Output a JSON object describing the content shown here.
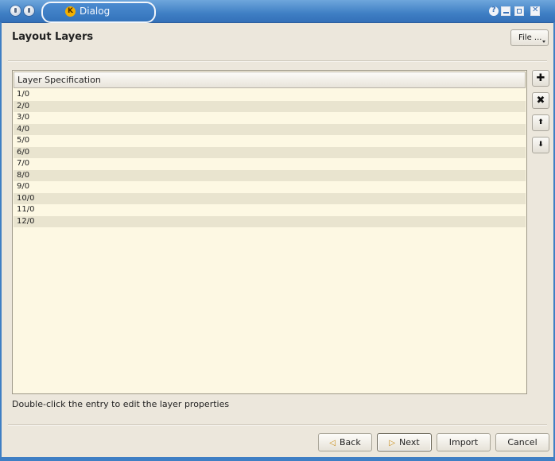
{
  "window": {
    "title": "Dialog",
    "logo_letter": "K"
  },
  "header": {
    "title": "Layout Layers",
    "file_button": "File ..."
  },
  "table": {
    "column_header": "Layer Specification",
    "rows": [
      "1/0",
      "2/0",
      "3/0",
      "4/0",
      "5/0",
      "6/0",
      "7/0",
      "8/0",
      "9/0",
      "10/0",
      "11/0",
      "12/0"
    ]
  },
  "side_buttons": {
    "add": "✚",
    "remove": "✖",
    "up": "⬆",
    "down": "⬇"
  },
  "hint": "Double-click the entry to edit the layer properties",
  "footer": {
    "back": "Back",
    "next": "Next",
    "import": "Import",
    "cancel": "Cancel"
  },
  "colors": {
    "titlebar": "#3f7fc4",
    "table_bg": "#fdf8e3",
    "row_alt": "#e9e4cf",
    "window_bg": "#ece7dc"
  }
}
